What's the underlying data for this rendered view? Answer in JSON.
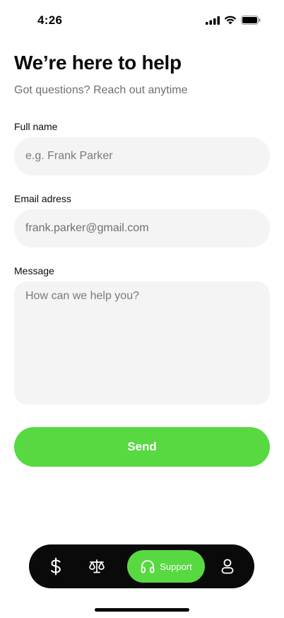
{
  "status_bar": {
    "time": "4:26",
    "icons": [
      "signal-icon",
      "wifi-icon",
      "battery-icon"
    ]
  },
  "header": {
    "title": "We’re here to help",
    "subtitle": "Got questions? Reach out anytime"
  },
  "form": {
    "full_name": {
      "label": "Full name",
      "value": "",
      "placeholder": "e.g. Frank Parker"
    },
    "email": {
      "label": "Email adress",
      "value": "frank.parker@gmail.com",
      "placeholder": ""
    },
    "message": {
      "label": "Message",
      "value": "",
      "placeholder": "How can we help you?"
    },
    "send_label": "Send"
  },
  "tab_bar": {
    "items": [
      {
        "icon": "dollar-icon",
        "label": ""
      },
      {
        "icon": "scale-icon",
        "label": ""
      },
      {
        "icon": "headphones-icon",
        "label": "Support",
        "active": true
      },
      {
        "icon": "profile-icon",
        "label": ""
      }
    ]
  },
  "colors": {
    "accent": "#58d941",
    "field_bg": "#f4f4f4",
    "tab_bar_bg": "#0a0a0a",
    "subtitle": "#6f6f6f"
  }
}
